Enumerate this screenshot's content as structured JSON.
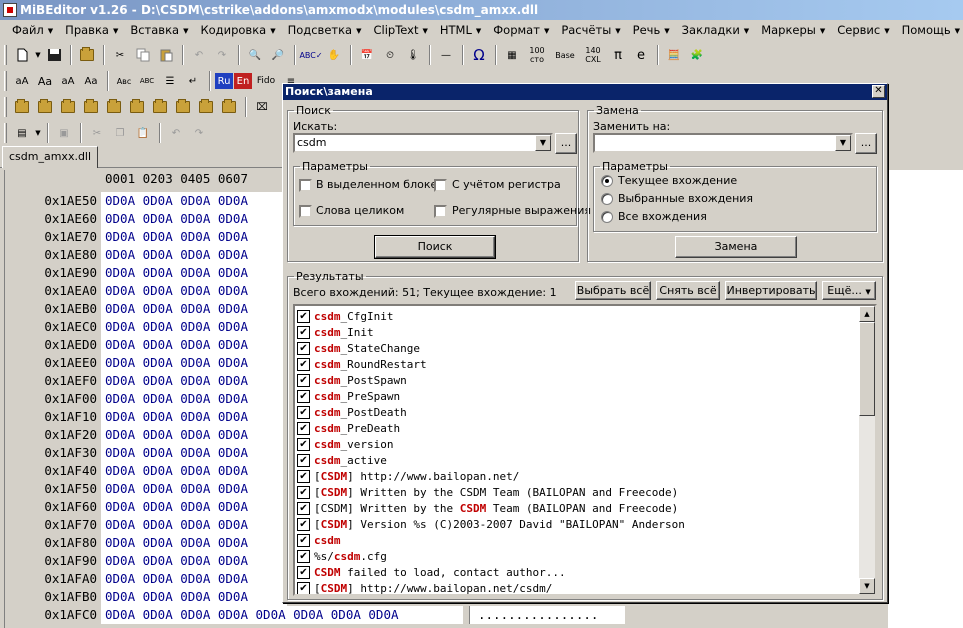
{
  "window": {
    "title": "MiBEditor v1.26 - D:\\CSDM\\cstrike\\addons\\amxmodx\\modules\\csdm_amxx.dll"
  },
  "menu": [
    "Файл",
    "Правка",
    "Вставка",
    "Кодировка",
    "Подсветка",
    "ClipText",
    "HTML",
    "Формат",
    "Расчёты",
    "Речь",
    "Закладки",
    "Маркеры",
    "Сервис",
    "Помощь"
  ],
  "toolbar": {
    "num_btn": "100\nсто",
    "base_btn": "Base",
    "cxl_btn": "140\nCXL",
    "pi_btn": "π",
    "e_btn": "e",
    "omega_btn": "Ω",
    "ru_btn": "Ru",
    "en_btn": "En",
    "fido_btn": "Fido",
    "abc_btn": "Авс"
  },
  "doc_tab": "csdm_amxx.dll",
  "hex": {
    "header": "0001 0203 0405 0607",
    "rows": [
      {
        "addr": "0x1AE50",
        "bytes": "0D0A 0D0A 0D0A 0D0A"
      },
      {
        "addr": "0x1AE60",
        "bytes": "0D0A 0D0A 0D0A 0D0A"
      },
      {
        "addr": "0x1AE70",
        "bytes": "0D0A 0D0A 0D0A 0D0A"
      },
      {
        "addr": "0x1AE80",
        "bytes": "0D0A 0D0A 0D0A 0D0A"
      },
      {
        "addr": "0x1AE90",
        "bytes": "0D0A 0D0A 0D0A 0D0A"
      },
      {
        "addr": "0x1AEA0",
        "bytes": "0D0A 0D0A 0D0A 0D0A"
      },
      {
        "addr": "0x1AEB0",
        "bytes": "0D0A 0D0A 0D0A 0D0A"
      },
      {
        "addr": "0x1AEC0",
        "bytes": "0D0A 0D0A 0D0A 0D0A"
      },
      {
        "addr": "0x1AED0",
        "bytes": "0D0A 0D0A 0D0A 0D0A"
      },
      {
        "addr": "0x1AEE0",
        "bytes": "0D0A 0D0A 0D0A 0D0A"
      },
      {
        "addr": "0x1AEF0",
        "bytes": "0D0A 0D0A 0D0A 0D0A"
      },
      {
        "addr": "0x1AF00",
        "bytes": "0D0A 0D0A 0D0A 0D0A"
      },
      {
        "addr": "0x1AF10",
        "bytes": "0D0A 0D0A 0D0A 0D0A"
      },
      {
        "addr": "0x1AF20",
        "bytes": "0D0A 0D0A 0D0A 0D0A"
      },
      {
        "addr": "0x1AF30",
        "bytes": "0D0A 0D0A 0D0A 0D0A"
      },
      {
        "addr": "0x1AF40",
        "bytes": "0D0A 0D0A 0D0A 0D0A"
      },
      {
        "addr": "0x1AF50",
        "bytes": "0D0A 0D0A 0D0A 0D0A"
      },
      {
        "addr": "0x1AF60",
        "bytes": "0D0A 0D0A 0D0A 0D0A"
      },
      {
        "addr": "0x1AF70",
        "bytes": "0D0A 0D0A 0D0A 0D0A"
      },
      {
        "addr": "0x1AF80",
        "bytes": "0D0A 0D0A 0D0A 0D0A"
      },
      {
        "addr": "0x1AF90",
        "bytes": "0D0A 0D0A 0D0A 0D0A"
      },
      {
        "addr": "0x1AFA0",
        "bytes": "0D0A 0D0A 0D0A 0D0A"
      },
      {
        "addr": "0x1AFB0",
        "bytes": "0D0A 0D0A 0D0A 0D0A"
      }
    ],
    "last_row": {
      "addr": "0x1AFC0",
      "bytes": "0D0A 0D0A 0D0A 0D0A 0D0A 0D0A 0D0A 0D0A",
      "ascii": "................"
    }
  },
  "dialog": {
    "title": "Поиск\\замена",
    "search": {
      "group": "Поиск",
      "label": "Искать:",
      "value": "csdm",
      "params_group": "Параметры",
      "in_selection": "В выделенном блоке",
      "match_case": "С учётом регистра",
      "whole_words": "Слова целиком",
      "regex": "Регулярные выражения",
      "button": "Поиск"
    },
    "replace": {
      "group": "Замена",
      "label": "Заменить на:",
      "value": "",
      "params_group": "Параметры",
      "current": "Текущее вхождение",
      "selected": "Выбранные вхождения",
      "all": "Все вхождения",
      "button": "Замена"
    },
    "results": {
      "group": "Результаты",
      "summary": "Всего вхождений: 51; Текущее вхождение: 1",
      "select_all": "Выбрать всё",
      "clear_all": "Снять всё",
      "invert": "Инвертировать",
      "more": "Ещё...",
      "items": [
        {
          "pre": "",
          "hl": "csdm",
          "post": "_CfgInit"
        },
        {
          "pre": "",
          "hl": "csdm",
          "post": "_Init"
        },
        {
          "pre": "",
          "hl": "csdm",
          "post": "_StateChange"
        },
        {
          "pre": "",
          "hl": "csdm",
          "post": "_RoundRestart"
        },
        {
          "pre": "",
          "hl": "csdm",
          "post": "_PostSpawn"
        },
        {
          "pre": "",
          "hl": "csdm",
          "post": "_PreSpawn"
        },
        {
          "pre": "",
          "hl": "csdm",
          "post": "_PostDeath"
        },
        {
          "pre": "",
          "hl": "csdm",
          "post": "_PreDeath"
        },
        {
          "pre": "",
          "hl": "csdm",
          "post": "_version"
        },
        {
          "pre": "",
          "hl": "csdm",
          "post": "_active"
        },
        {
          "pre": "[",
          "hl": "CSDM",
          "post": "] http://www.bailopan.net/"
        },
        {
          "pre": "[",
          "hl": "CSDM",
          "post": "] Written by the CSDM Team (BAILOPAN and Freecode)"
        },
        {
          "pre": "[CSDM] Written by the ",
          "hl": "CSDM",
          "post": " Team (BAILOPAN and Freecode)"
        },
        {
          "pre": "[",
          "hl": "CSDM",
          "post": "] Version %s (C)2003-2007 David \"BAILOPAN\" Anderson"
        },
        {
          "pre": "",
          "hl": "csdm",
          "post": ""
        },
        {
          "pre": "%s/",
          "hl": "csdm",
          "post": ".cfg"
        },
        {
          "pre": "",
          "hl": "CSDM",
          "post": " failed to load, contact author..."
        },
        {
          "pre": "[",
          "hl": "CSDM",
          "post": "] http://www.bailopan.net/csdm/"
        }
      ]
    }
  }
}
